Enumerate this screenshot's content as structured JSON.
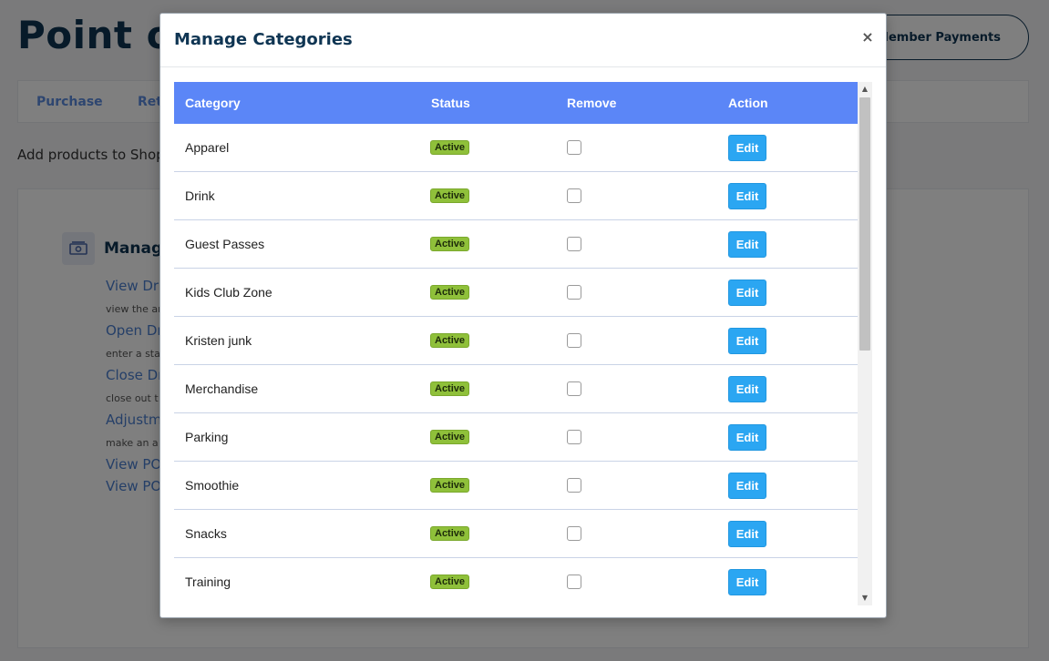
{
  "background": {
    "page_title": "Point of",
    "member_payments_label": "Member Payments",
    "tabs": [
      "Purchase",
      "Ret"
    ],
    "subtitle": "Add products to Shopp",
    "card": {
      "title": "Manage",
      "links": [
        {
          "label": "View Dra",
          "desc": "view the ar"
        },
        {
          "label": "Open Dr",
          "desc": "enter a sta"
        },
        {
          "label": "Close Dr",
          "desc": "close out t"
        },
        {
          "label": "Adjustm",
          "desc": "make an a"
        },
        {
          "label": "View PO",
          "desc": ""
        },
        {
          "label": "View PO",
          "desc": ""
        }
      ]
    }
  },
  "modal": {
    "title": "Manage Categories",
    "close_icon": "×",
    "columns": {
      "category": "Category",
      "status": "Status",
      "remove": "Remove",
      "action": "Action"
    },
    "rows": [
      {
        "name": "Apparel",
        "status": "Active",
        "action": "Edit"
      },
      {
        "name": "Drink",
        "status": "Active",
        "action": "Edit"
      },
      {
        "name": "Guest Passes",
        "status": "Active",
        "action": "Edit"
      },
      {
        "name": "Kids Club Zone",
        "status": "Active",
        "action": "Edit"
      },
      {
        "name": "Kristen junk",
        "status": "Active",
        "action": "Edit"
      },
      {
        "name": "Merchandise",
        "status": "Active",
        "action": "Edit"
      },
      {
        "name": "Parking",
        "status": "Active",
        "action": "Edit"
      },
      {
        "name": "Smoothie",
        "status": "Active",
        "action": "Edit"
      },
      {
        "name": "Snacks",
        "status": "Active",
        "action": "Edit"
      },
      {
        "name": "Training",
        "status": "Active",
        "action": "Edit"
      }
    ]
  },
  "colors": {
    "header_bg": "#5b86f7",
    "badge_bg": "#8fc03a",
    "edit_button_bg": "#2ba6f2",
    "title_color": "#0f3553"
  },
  "icons": {
    "card_icon": "money-icon",
    "close": "close-icon",
    "scroll_up": "scroll-up-icon",
    "scroll_down": "scroll-down-icon"
  }
}
